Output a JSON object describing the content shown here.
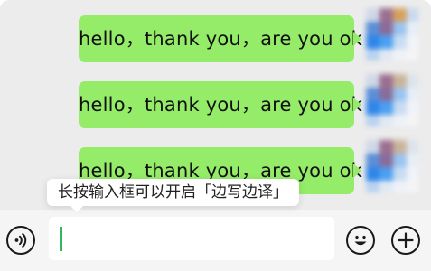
{
  "conversation": {
    "messages": [
      {
        "text": "hello，thank you，are you ok",
        "sender": "self"
      },
      {
        "text": "hello，thank you，are you ok",
        "sender": "self"
      },
      {
        "text": "hello，thank you，are you ok",
        "sender": "self"
      }
    ]
  },
  "tooltip": {
    "text": "长按输入框可以开启「边写边译」"
  },
  "input_bar": {
    "value": "",
    "voice_icon": "voice-icon",
    "emoji_icon": "emoji-icon",
    "more_icon": "plus-icon"
  },
  "colors": {
    "bubble": "#95ec69",
    "chat_background": "#ececec",
    "caret": "#2eb95a"
  }
}
